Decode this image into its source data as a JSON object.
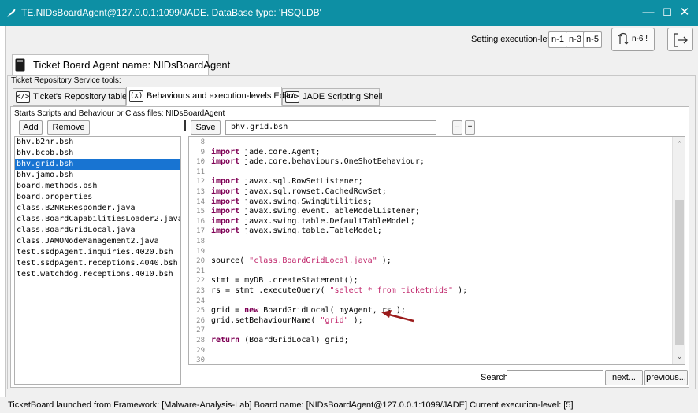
{
  "window": {
    "title": "TE.NIDsBoardAgent@127.0.0.1:1099/JADE. DataBase type: 'HSQLDB'",
    "app_icon": "feather-icon",
    "minimize_glyph": "—",
    "maximize_glyph": "☐",
    "close_glyph": "✕"
  },
  "exec_bar": {
    "label": "Setting execution-level:",
    "levels": [
      "n-1",
      "n-3",
      "n-5"
    ],
    "undo_label": "n-6 !",
    "undo_icon": "cycle-arrow-icon",
    "exit_icon": "exit-icon"
  },
  "agent": {
    "title": "Ticket Board Agent name: NIDsBoardAgent",
    "icon": "book-icon"
  },
  "repo": {
    "legend": "Ticket Repository Service tools:",
    "tabs": [
      {
        "icon_text": "</>",
        "label": "Ticket's Repository table",
        "active": false
      },
      {
        "icon_text": "(x)",
        "label": "Behaviours and execution-levels Editor",
        "active": true
      },
      {
        "icon_text": "</>",
        "label": "JADE Scripting Shell",
        "active": false
      }
    ]
  },
  "editor_panel": {
    "legend": "Starts Scripts and Behaviour or Class files: NIDsBoardAgent",
    "add_label": "Add",
    "remove_label": "Remove",
    "save_label": "Save",
    "filename": "bhv.grid.bsh",
    "minus_label": "–",
    "plus_label": "+",
    "files": [
      "bhv.b2nr.bsh",
      "bhv.bcpb.bsh",
      "bhv.grid.bsh",
      "bhv.jamo.bsh",
      "board.methods.bsh",
      "board.properties",
      "class.B2NREResponder.java",
      "class.BoardCapabilitiesLoader2.java",
      "class.BoardGridLocal.java",
      "class.JAMONodeManagement2.java",
      "test.ssdpAgent.inquiries.4020.bsh",
      "test.ssdpAgent.receptions.4040.bsh",
      "test.watchdog.receptions.4010.bsh"
    ],
    "selected_file": "bhv.grid.bsh",
    "code_lines": [
      {
        "n": "8",
        "parts": []
      },
      {
        "n": "9",
        "parts": [
          [
            "kw",
            "import"
          ],
          [
            "t",
            " jade.core.Agent;"
          ]
        ]
      },
      {
        "n": "10",
        "parts": [
          [
            "kw",
            "import"
          ],
          [
            "t",
            " jade.core.behaviours.OneShotBehaviour;"
          ]
        ]
      },
      {
        "n": "11",
        "parts": []
      },
      {
        "n": "12",
        "parts": [
          [
            "kw",
            "import"
          ],
          [
            "t",
            " javax.sql.RowSetListener;"
          ]
        ]
      },
      {
        "n": "13",
        "parts": [
          [
            "kw",
            "import"
          ],
          [
            "t",
            " javax.sql.rowset.CachedRowSet;"
          ]
        ]
      },
      {
        "n": "14",
        "parts": [
          [
            "kw",
            "import"
          ],
          [
            "t",
            " javax.swing.SwingUtilities;"
          ]
        ]
      },
      {
        "n": "15",
        "parts": [
          [
            "kw",
            "import"
          ],
          [
            "t",
            " javax.swing.event.TableModelListener;"
          ]
        ]
      },
      {
        "n": "16",
        "parts": [
          [
            "kw",
            "import"
          ],
          [
            "t",
            " javax.swing.table.DefaultTableModel;"
          ]
        ]
      },
      {
        "n": "17",
        "parts": [
          [
            "kw",
            "import"
          ],
          [
            "t",
            " javax.swing.table.TableModel;"
          ]
        ]
      },
      {
        "n": "18",
        "parts": []
      },
      {
        "n": "19",
        "parts": []
      },
      {
        "n": "20",
        "parts": [
          [
            "t",
            "source( "
          ],
          [
            "str",
            "\"class.BoardGridLocal.java\""
          ],
          [
            "t",
            " );"
          ]
        ]
      },
      {
        "n": "21",
        "parts": []
      },
      {
        "n": "22",
        "parts": [
          [
            "t",
            "stmt = myDB .createStatement();"
          ]
        ]
      },
      {
        "n": "23",
        "parts": [
          [
            "t",
            "rs = stmt .executeQuery( "
          ],
          [
            "str",
            "\"select * from ticketnids\""
          ],
          [
            "t",
            " );"
          ]
        ]
      },
      {
        "n": "24",
        "parts": []
      },
      {
        "n": "25",
        "parts": [
          [
            "t",
            "grid = "
          ],
          [
            "kw",
            "new"
          ],
          [
            "t",
            " BoardGridLocal( myAgent, rs );"
          ]
        ]
      },
      {
        "n": "26",
        "parts": [
          [
            "t",
            "grid.setBehaviourName( "
          ],
          [
            "str",
            "\"grid\""
          ],
          [
            "t",
            " );"
          ]
        ]
      },
      {
        "n": "27",
        "parts": []
      },
      {
        "n": "28",
        "parts": [
          [
            "kw",
            "return"
          ],
          [
            "t",
            " (BoardGridLocal) grid;"
          ]
        ]
      },
      {
        "n": "29",
        "parts": []
      },
      {
        "n": "30",
        "parts": []
      }
    ],
    "search_label": "Search",
    "search_value": "",
    "next_label": "next...",
    "previous_label": "previous..."
  },
  "status": {
    "text": "TicketBoard launched from Framework: [Malware-Analysis-Lab] Board name: [NIDsBoardAgent@127.0.0.1:1099/JADE] Current execution-level: [5]"
  },
  "colors": {
    "titlebar": "#0d8fa4",
    "selection": "#1874d2",
    "keyword": "#7f0055",
    "string": "#c0266b",
    "annotation_arrow": "#9b1b1b"
  }
}
